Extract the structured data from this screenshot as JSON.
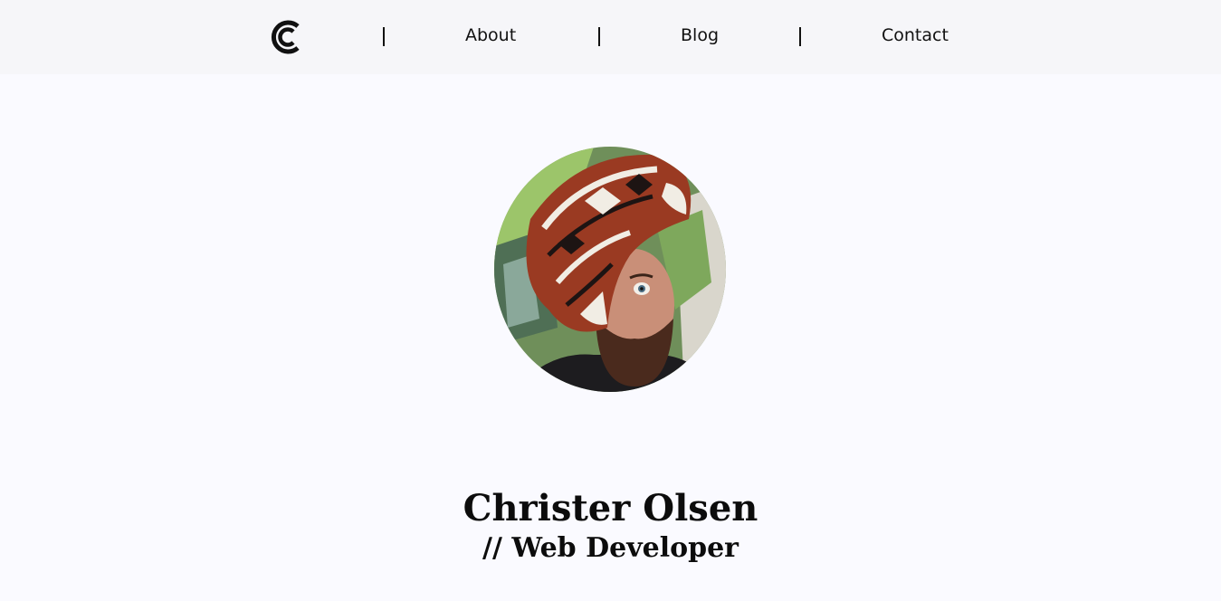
{
  "nav": {
    "logo_icon": "concentric-c-logo-icon",
    "links": [
      {
        "label": "About"
      },
      {
        "label": "Blog"
      },
      {
        "label": "Contact"
      }
    ]
  },
  "hero": {
    "avatar_icon": "profile-photo",
    "name": "Christer Olsen",
    "role": "// Web Developer"
  },
  "colors": {
    "header_bg": "#f6f6f9",
    "page_bg": "#fafaff",
    "text": "#111111"
  }
}
